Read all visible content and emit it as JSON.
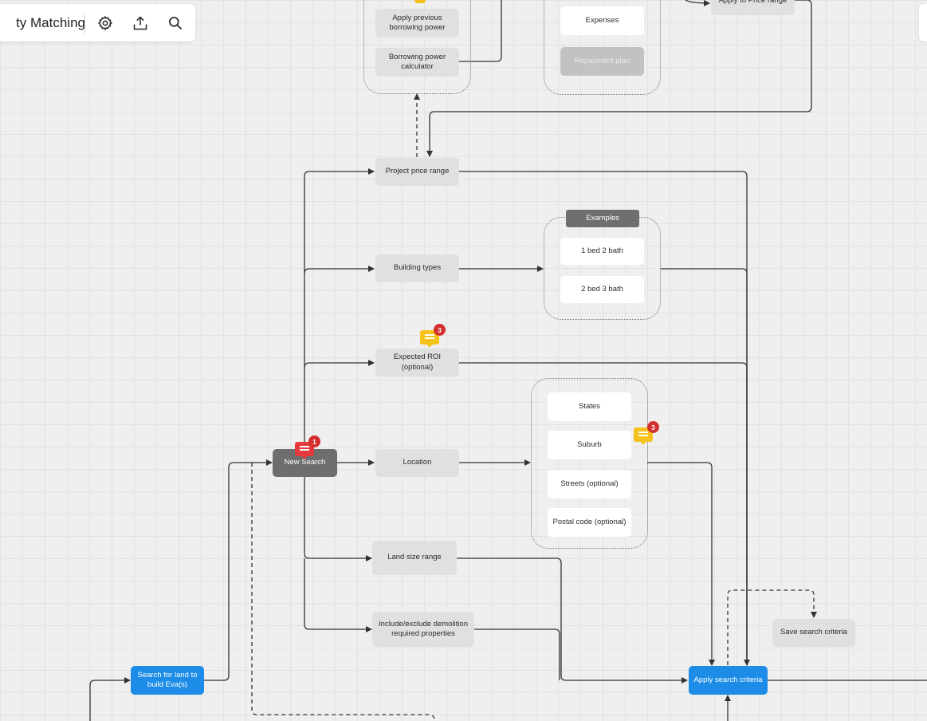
{
  "toolbar": {
    "title": "ty Matching",
    "icons": [
      "gear-icon",
      "upload-icon",
      "search-icon"
    ]
  },
  "nodes": {
    "apply_previous": "Apply previous borrowing power",
    "borrowing_calc": "Borrowing power calculator",
    "expenses": "Expenses",
    "repayment_plan": "Repayment plan",
    "apply_price_range": "Apply to Price range",
    "project_price_range": "Project price range",
    "examples_header": "Examples",
    "bed_1_2": "1 bed 2 bath",
    "bed_2_3": "2 bed 3 bath",
    "building_types": "Building types",
    "expected_roi": "Expected ROI (optional)",
    "states": "States",
    "suburb": "Suburb",
    "streets": "Streets (optional)",
    "postal_code": "Postal code (optional)",
    "new_search": "New Search",
    "location": "Location",
    "land_size": "Land size range",
    "demolition": "Include/exclude demolition required properties",
    "search_land": "Search for land to build Eva(s)",
    "apply_search": "Apply search criteria",
    "save_search": "Save search criteria"
  },
  "comments": {
    "roi_count": "3",
    "suburb_count": "3",
    "new_search_count": "1"
  },
  "colors": {
    "blue": "#1d8ce6",
    "dark_node": "#6e6e6e",
    "grey_node": "#e0e0e0",
    "comment_yellow": "#f5c21b",
    "comment_red": "#e5393b",
    "badge_red": "#d32f2f"
  }
}
